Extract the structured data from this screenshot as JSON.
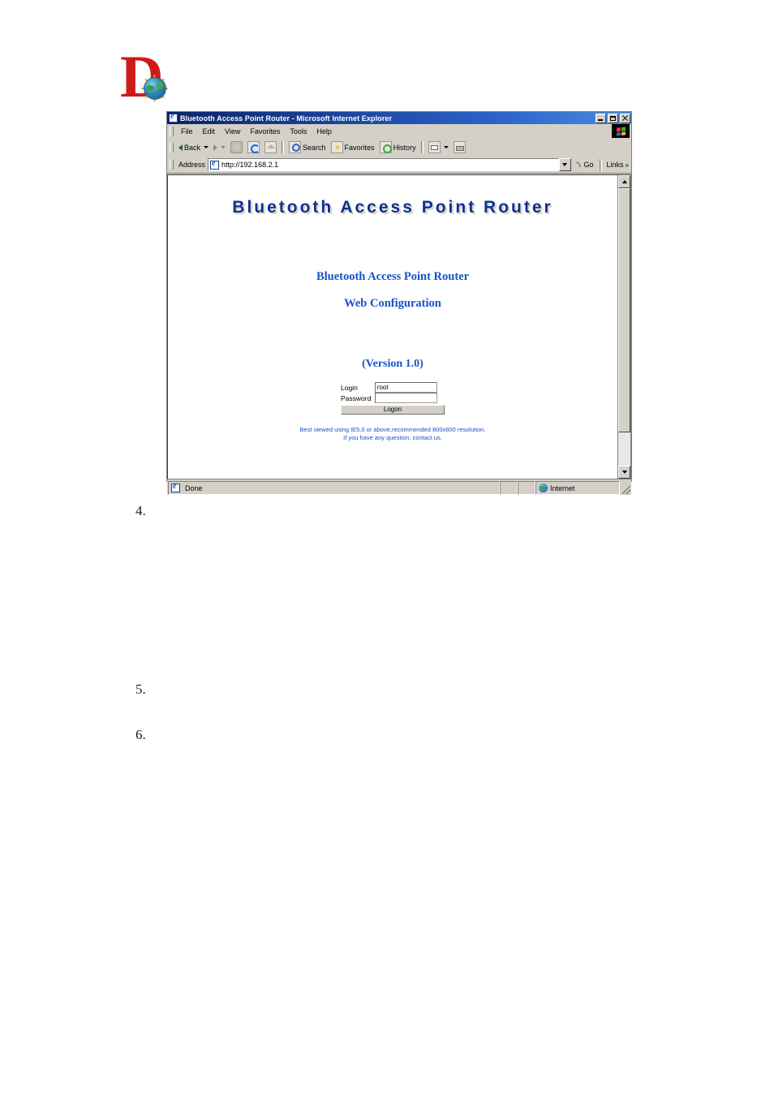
{
  "document": {
    "logo_letter": "D",
    "steps": [
      {
        "number": "4."
      },
      {
        "number": "5."
      },
      {
        "number": "6."
      }
    ]
  },
  "browser": {
    "title": "Bluetooth Access Point Router - Microsoft Internet Explorer",
    "window_buttons": {
      "minimize": "Minimize",
      "maximize": "Maximize",
      "close": "Close"
    },
    "menu": [
      {
        "label": "File"
      },
      {
        "label": "Edit"
      },
      {
        "label": "View"
      },
      {
        "label": "Favorites"
      },
      {
        "label": "Tools"
      },
      {
        "label": "Help"
      }
    ],
    "toolbar": {
      "back": "Back",
      "forward": "",
      "stop": "",
      "refresh": "",
      "home": "",
      "search": "Search",
      "favorites": "Favorites",
      "history": "History",
      "mail": "",
      "print": ""
    },
    "address": {
      "label": "Address",
      "url": "http://192.168.2.1",
      "go": "Go",
      "links": "Links",
      "links_chevron": "»"
    },
    "status": {
      "message": "Done",
      "zone": "Internet"
    }
  },
  "page": {
    "banner": "Bluetooth  Access  Point  Router",
    "heading_1": "Bluetooth Access Point Router",
    "heading_2": "Web Configuration",
    "version": "(Version 1.0)",
    "form": {
      "login_label": "Login",
      "login_value": "root",
      "password_label": "Password",
      "password_value": "",
      "submit_label": "Logon"
    },
    "footer_line_1": "Best viewed using IE5.0 or above,recommended 800x600 resolution.",
    "footer_line_2": "If you have any question, contact us."
  },
  "colors": {
    "banner_blue": "#0e2f9e",
    "heading_blue": "#1a52c8",
    "titlebar_blue": "#0a246a",
    "chrome_gray": "#d4d0c8",
    "logo_red": "#d01a18"
  }
}
